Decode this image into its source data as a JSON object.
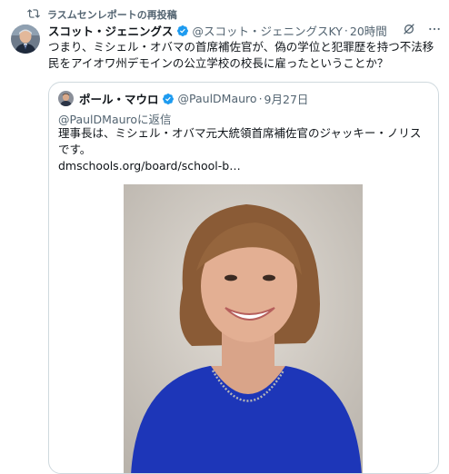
{
  "repost": {
    "label": "ラスムセンレポートの再投稿",
    "icon": "repost-icon"
  },
  "tweet": {
    "author": {
      "display_name": "スコット・ジェニングス",
      "handle": "@スコット・ジェニングスKY",
      "verified": true,
      "avatar_icon": "avatar"
    },
    "separator": "·",
    "time": "20時間",
    "text": "つまり、ミシェル・オバマの首席補佐官が、偽の学位と犯罪歴を持つ不法移民をアイオワ州デモインの公立学校の校長に雇ったということか？",
    "header_icons": [
      "grok-icon",
      "more-options-icon"
    ]
  },
  "quote": {
    "author": {
      "display_name": "ポール・マウロ",
      "handle": "@PaulDMauro",
      "verified": true
    },
    "separator": "·",
    "date": "9月27日",
    "reply_to": "@PaulDMauroに返信",
    "text": "理事長は、ミシェル・オバマ元大統領首席補佐官のジャッキー・ノリスです。",
    "link": "dmschools.org/board/school-b…"
  },
  "colors": {
    "text_primary": "#0f1419",
    "text_secondary": "#536471",
    "verified_blue": "#1d9bf0",
    "border": "#cfd9de"
  }
}
